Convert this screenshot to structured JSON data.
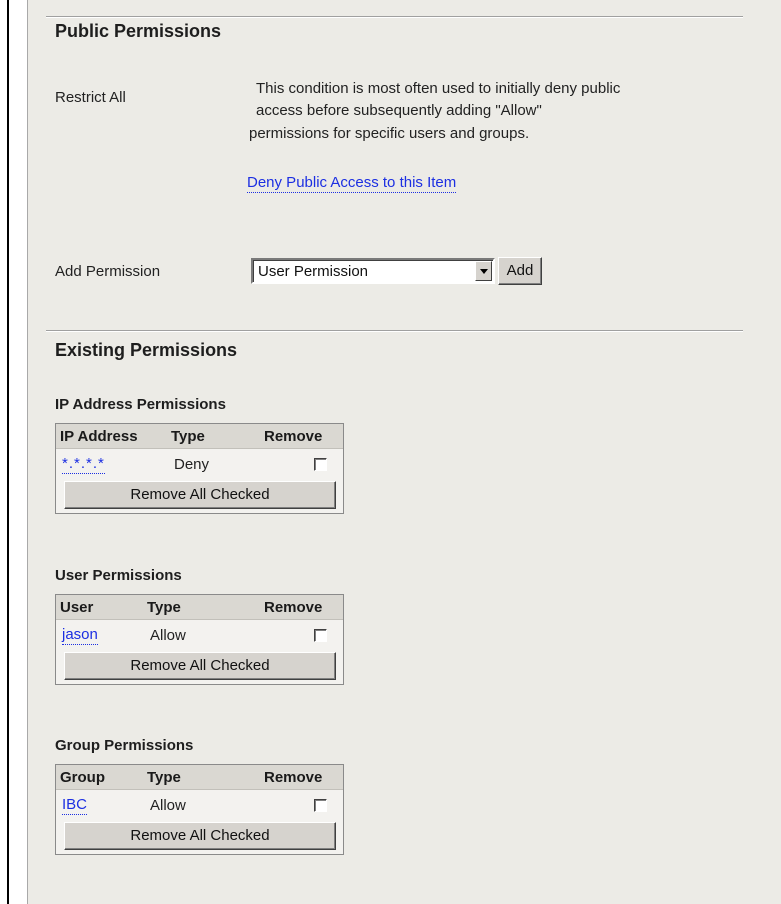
{
  "public": {
    "title": "Public Permissions",
    "restrict_label": "Restrict All",
    "restrict_desc_1": "This condition is most often used to initially deny public",
    "restrict_desc_2": "access before subsequently adding \"Allow\"",
    "restrict_desc_3": "permissions for specific users and groups.",
    "deny_link": "Deny Public Access to this Item",
    "add_label": "Add Permission",
    "add_select_value": "User Permission",
    "add_button": "Add"
  },
  "existing": {
    "title": "Existing Permissions",
    "ip": {
      "title": "IP Address Permissions",
      "headers": [
        "IP Address",
        "Type",
        "Remove"
      ],
      "rows": [
        {
          "name": "*.*.*.*",
          "type": "Deny",
          "checked": false
        }
      ],
      "remove_button": "Remove All Checked"
    },
    "user": {
      "title": "User Permissions",
      "headers": [
        "User",
        "Type",
        "Remove"
      ],
      "rows": [
        {
          "name": "jason",
          "type": "Allow",
          "checked": false
        }
      ],
      "remove_button": "Remove All Checked"
    },
    "group": {
      "title": "Group Permissions",
      "headers": [
        "Group",
        "Type",
        "Remove"
      ],
      "rows": [
        {
          "name": "IBC",
          "type": "Allow",
          "checked": false
        }
      ],
      "remove_button": "Remove All Checked"
    }
  },
  "colors": {
    "link": "#1c2fe2",
    "panel_bg": "#ecebe6",
    "table_header_bg": "#dad8d2",
    "button_face": "#d6d3ce"
  }
}
